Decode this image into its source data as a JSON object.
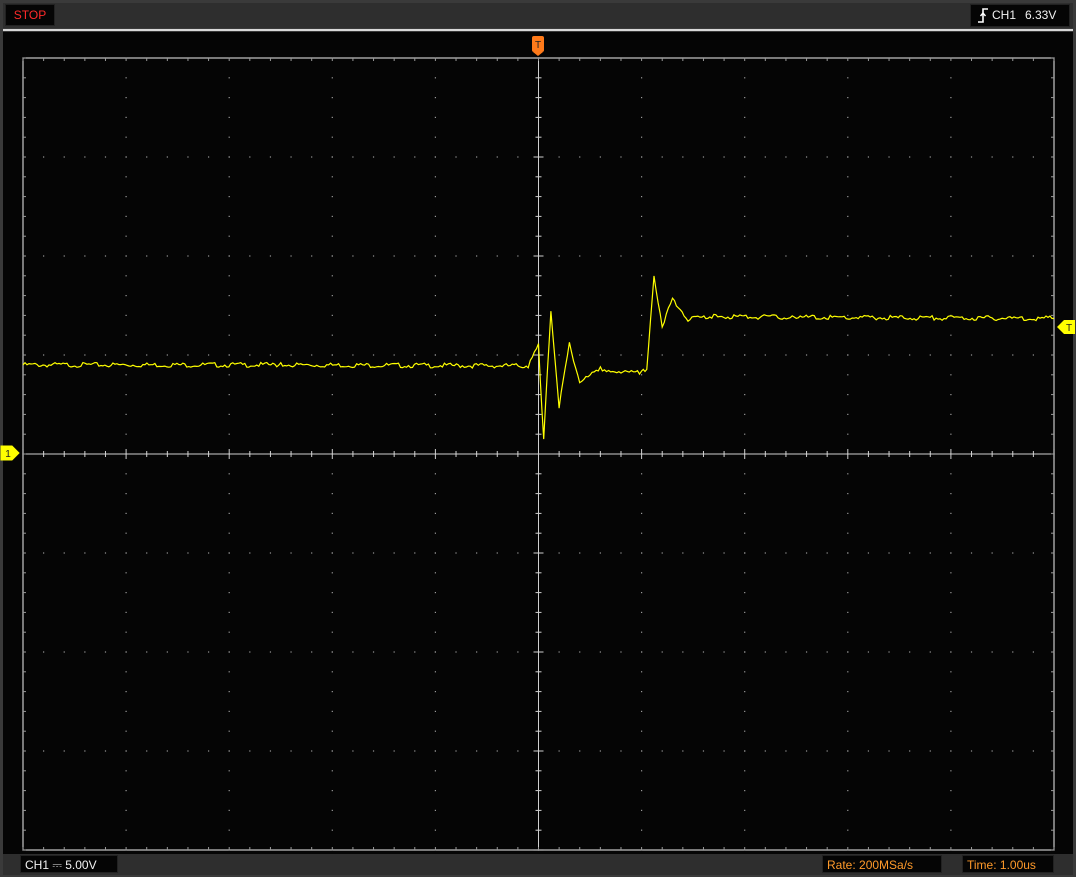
{
  "status": {
    "label": "STOP",
    "color": "#ff2a2a"
  },
  "trigger": {
    "edge_icon": "rising-edge-icon",
    "channel": "CH1",
    "level": "6.33V",
    "marker_label": "T",
    "marker_color": "#ff7a1a"
  },
  "channel": {
    "name": "CH1",
    "coupling_icon": "dc-coupling-icon",
    "label": "CH1 ⎓ 5.00V",
    "scale": "5.00V",
    "marker_label": "1",
    "trace_color": "#ffff00"
  },
  "acquisition": {
    "rate": "Rate: 200MSa/s",
    "timebase": "Time: 1.00us"
  },
  "chart_data": {
    "type": "line",
    "grid": true,
    "x_divisions": 10,
    "y_divisions": 8,
    "x_unit_per_div": "1.00us",
    "y_unit_per_div": "5.00V",
    "series": [
      {
        "color": "#ffff00",
        "points": [
          [
            -5.0,
            4.5
          ],
          [
            -2.5,
            4.5
          ],
          [
            -0.1,
            4.45
          ],
          [
            0.0,
            5.5
          ],
          [
            0.05,
            0.8
          ],
          [
            0.12,
            7.2
          ],
          [
            0.2,
            2.4
          ],
          [
            0.3,
            5.6
          ],
          [
            0.4,
            3.6
          ],
          [
            0.6,
            4.3
          ],
          [
            0.8,
            4.1
          ],
          [
            1.0,
            4.1
          ],
          [
            1.05,
            4.3
          ],
          [
            1.12,
            8.9
          ],
          [
            1.2,
            6.5
          ],
          [
            1.3,
            7.8
          ],
          [
            1.45,
            6.8
          ],
          [
            1.7,
            6.95
          ],
          [
            2.5,
            6.9
          ],
          [
            5.0,
            6.85
          ]
        ]
      }
    ]
  }
}
